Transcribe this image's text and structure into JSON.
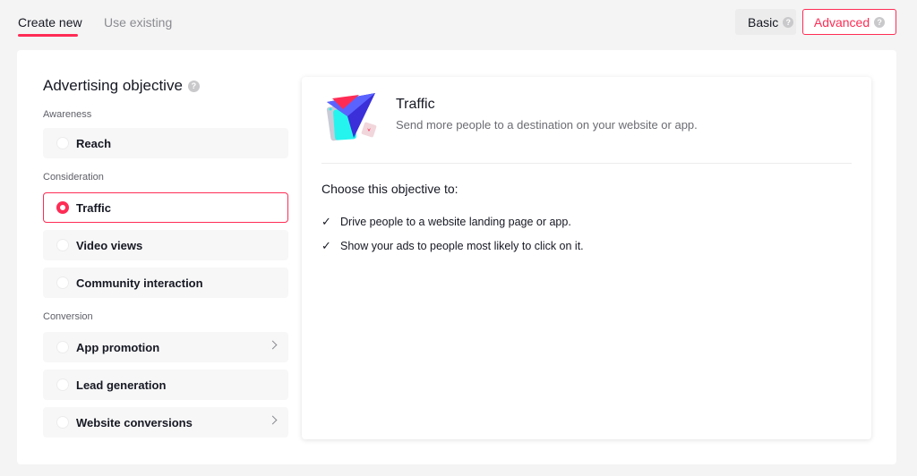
{
  "tabs": [
    {
      "label": "Create new",
      "active": true
    },
    {
      "label": "Use existing",
      "active": false
    }
  ],
  "modes": {
    "basic": {
      "label": "Basic",
      "help_icon": "question-circle-icon"
    },
    "advanced": {
      "label": "Advanced",
      "help_icon": "question-circle-icon",
      "selected": true
    }
  },
  "colors": {
    "accent": "#fe2c55",
    "text": "#161823",
    "muted": "#8a8b91"
  },
  "objective": {
    "title": "Advertising objective",
    "help_icon": "question-circle-icon",
    "groups": [
      {
        "label": "Awareness",
        "options": [
          {
            "label": "Reach",
            "selected": false,
            "has_chevron": false
          }
        ]
      },
      {
        "label": "Consideration",
        "options": [
          {
            "label": "Traffic",
            "selected": true,
            "has_chevron": false
          },
          {
            "label": "Video views",
            "selected": false,
            "has_chevron": false
          },
          {
            "label": "Community interaction",
            "selected": false,
            "has_chevron": false
          }
        ]
      },
      {
        "label": "Conversion",
        "options": [
          {
            "label": "App promotion",
            "selected": false,
            "has_chevron": true
          },
          {
            "label": "Lead generation",
            "selected": false,
            "has_chevron": false
          },
          {
            "label": "Website conversions",
            "selected": false,
            "has_chevron": true
          }
        ]
      }
    ]
  },
  "detail": {
    "illustration_icon": "traffic-arrow-illustration",
    "title": "Traffic",
    "description": "Send more people to a destination on your website or app.",
    "choose_heading": "Choose this objective to:",
    "bullets": [
      "Drive people to a website landing page or app.",
      "Show your ads to people most likely to click on it."
    ],
    "check_icon": "checkmark-icon"
  }
}
